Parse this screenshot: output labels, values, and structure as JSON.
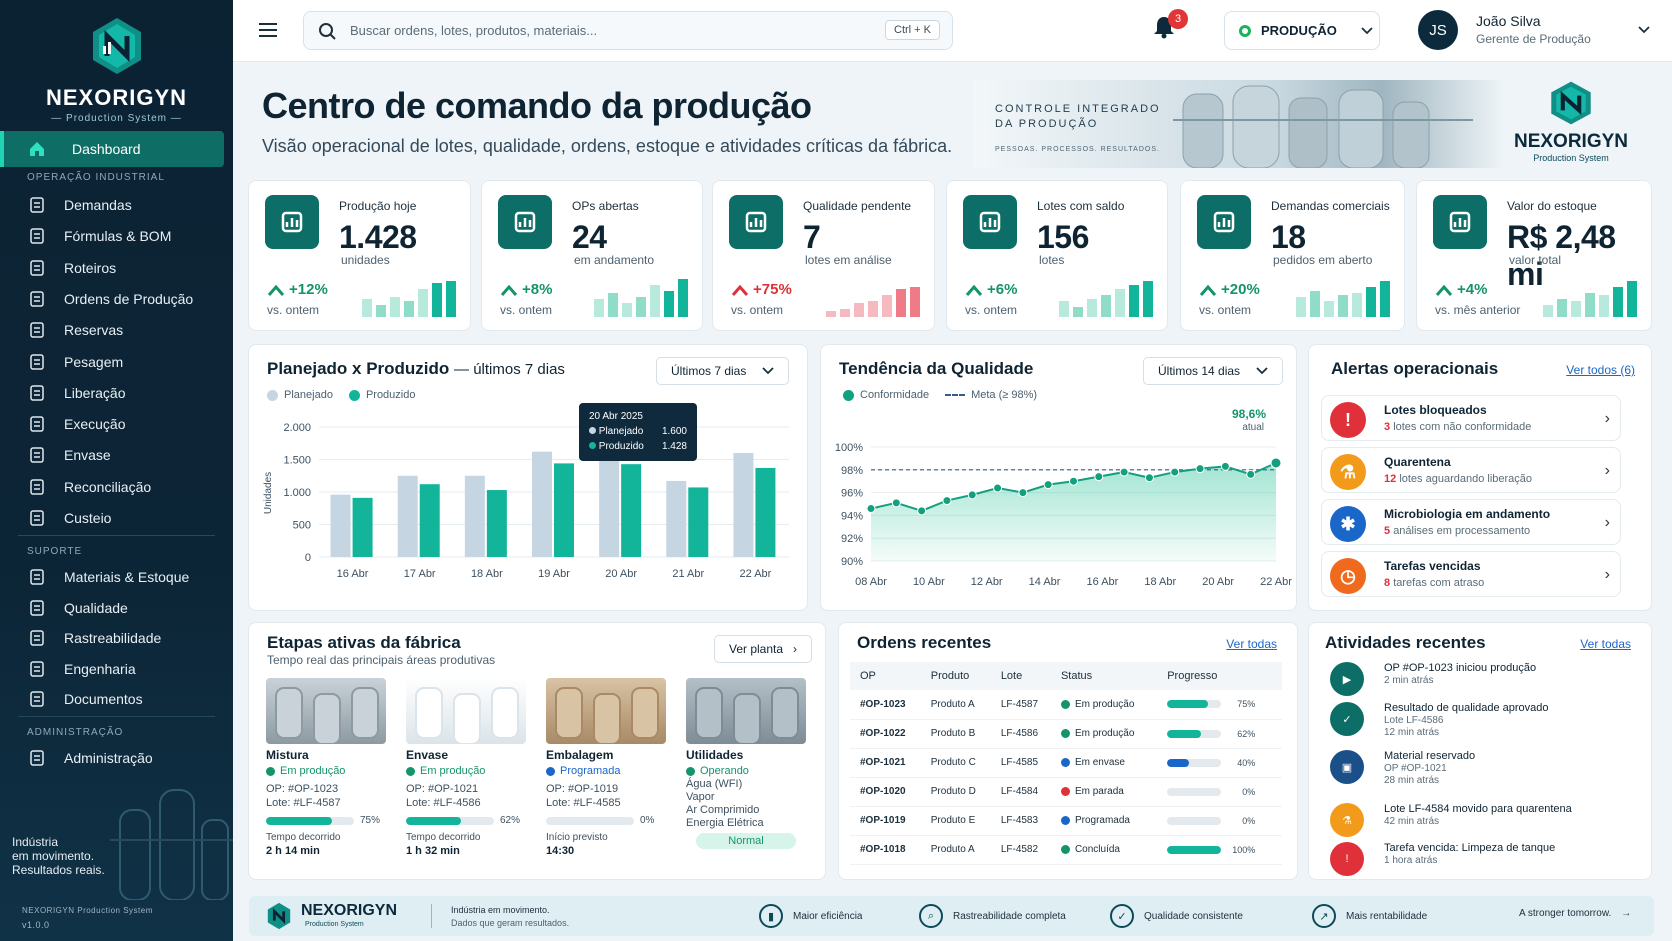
{
  "brand": {
    "name": "NEXORIGYN",
    "subtitle": "Production System"
  },
  "sidebar": {
    "active": "Dashboard",
    "section1": "OPERAÇÃO INDUSTRIAL",
    "items1": [
      "Demandas",
      "Fórmulas & BOM",
      "Roteiros",
      "Ordens de Produção",
      "Reservas",
      "Pesagem",
      "Liberação",
      "Execução",
      "Envase",
      "Reconciliação",
      "Custeio"
    ],
    "section2": "SUPORTE",
    "items2": [
      "Materiais & Estoque",
      "Qualidade",
      "Rastreabilidade",
      "Engenharia",
      "Documentos"
    ],
    "section3": "ADMINISTRAÇÃO",
    "items3": [
      "Administração"
    ],
    "tagline": [
      "Indústria",
      "em movimento.",
      "Resultados reais."
    ],
    "footer": "NEXORIGYN Production System",
    "version": "v1.0.0"
  },
  "topbar": {
    "search_placeholder": "Buscar ordens, lotes, produtos, materiais...",
    "shortcut": "Ctrl + K",
    "notifications": "3",
    "environment": "PRODUÇÃO",
    "user_initials": "JS",
    "user_name": "João Silva",
    "user_role": "Gerente de Produção"
  },
  "header": {
    "title": "Centro de comando da produção",
    "subtitle": "Visão operacional de lotes, qualidade, ordens, estoque e atividades críticas da fábrica.",
    "banner_line1": "CONTROLE INTEGRADO",
    "banner_line2": "DA PRODUÇÃO",
    "banner_small": "PESSOAS. PROCESSOS. RESULTADOS."
  },
  "kpis": [
    {
      "label": "Produção hoje",
      "value": "1.428",
      "unit": "unidades",
      "delta": "+12%",
      "compare": "vs. ontem",
      "trend": "up",
      "spark": [
        0.45,
        0.3,
        0.5,
        0.4,
        0.7,
        0.85,
        0.9
      ]
    },
    {
      "label": "OPs abertas",
      "value": "24",
      "unit": "em andamento",
      "delta": "+8%",
      "compare": "vs. ontem",
      "trend": "up",
      "spark": [
        0.45,
        0.6,
        0.35,
        0.5,
        0.8,
        0.65,
        0.95
      ]
    },
    {
      "label": "Qualidade pendente",
      "value": "7",
      "unit": "lotes em análise",
      "delta": "+75%",
      "compare": "vs. ontem",
      "trend": "down",
      "spark": [
        0.15,
        0.2,
        0.35,
        0.4,
        0.55,
        0.7,
        0.75
      ]
    },
    {
      "label": "Lotes com saldo",
      "value": "156",
      "unit": "lotes",
      "delta": "+6%",
      "compare": "vs. ontem",
      "trend": "up",
      "spark": [
        0.4,
        0.25,
        0.45,
        0.55,
        0.7,
        0.8,
        0.9
      ]
    },
    {
      "label": "Demandas comerciais",
      "value": "18",
      "unit": "pedidos em aberto",
      "delta": "+20%",
      "compare": "vs. ontem",
      "trend": "up",
      "spark": [
        0.5,
        0.65,
        0.4,
        0.55,
        0.6,
        0.75,
        0.9
      ]
    },
    {
      "label": "Valor do estoque",
      "value": "R$ 2,48 mi",
      "unit": "valor total",
      "delta": "+4%",
      "compare": "vs. mês anterior",
      "trend": "up",
      "spark": [
        0.3,
        0.45,
        0.4,
        0.6,
        0.55,
        0.75,
        0.9
      ]
    }
  ],
  "chart_data": [
    {
      "type": "bar",
      "title": "Planejado x Produzido",
      "subtitle": "— últimos 7 dias",
      "filter": "Últimos 7 dias",
      "ylabel": "Unidades",
      "ylim": [
        0,
        2000
      ],
      "yticks": [
        "2.000",
        "1.500",
        "1.000",
        "500",
        "0"
      ],
      "categories": [
        "16 Abr",
        "17 Abr",
        "18 Abr",
        "19 Abr",
        "20 Abr",
        "21 Abr",
        "22 Abr"
      ],
      "series": [
        {
          "name": "Planejado",
          "color": "#c5d6e2",
          "values": [
            960,
            1250,
            1250,
            1620,
            1600,
            1170,
            1600
          ]
        },
        {
          "name": "Produzido",
          "color": "#12b59a",
          "values": [
            910,
            1120,
            1030,
            1440,
            1428,
            1070,
            1370
          ]
        }
      ],
      "tooltip": {
        "date": "20 Abr 2025",
        "planned_label": "Planejado",
        "planned": "1.600",
        "produced_label": "Produzido",
        "produced": "1.428"
      }
    },
    {
      "type": "area",
      "title": "Tendência da Qualidade",
      "filter": "Últimos 14 dias",
      "ylim": [
        90,
        100
      ],
      "yticks": [
        "100%",
        "98%",
        "96%",
        "94%",
        "92%",
        "90%"
      ],
      "xticks": [
        "08 Abr",
        "10 Abr",
        "12 Abr",
        "14 Abr",
        "16 Abr",
        "18 Abr",
        "20 Abr",
        "22 Abr"
      ],
      "series": [
        {
          "name": "Conformidade",
          "color": "#12a07f",
          "values": [
            94.6,
            95.1,
            94.4,
            95.3,
            95.8,
            96.4,
            96.0,
            96.7,
            97.0,
            97.4,
            97.8,
            97.3,
            97.8,
            98.1,
            98.3,
            97.6,
            98.6
          ]
        },
        {
          "name": "Meta (≥ 98%)",
          "values": [
            98
          ]
        }
      ],
      "last_label": "98,6%",
      "last_sub": "atual"
    }
  ],
  "alerts": {
    "title": "Alertas operacionais",
    "link": "Ver todos (6)",
    "items": [
      {
        "title": "Lotes bloqueados",
        "count": "3",
        "text": "lotes com não conformidade",
        "color": "#e0303a",
        "icon": "warning-icon"
      },
      {
        "title": "Quarentena",
        "count": "12",
        "text": "lotes aguardando liberação",
        "color": "#f29a1a",
        "icon": "flask-icon"
      },
      {
        "title": "Microbiologia em andamento",
        "count": "5",
        "text": "análises em processamento",
        "color": "#1b66c9",
        "icon": "microbe-icon"
      },
      {
        "title": "Tarefas vencidas",
        "count": "8",
        "text": "tarefas com atraso",
        "color": "#f06a1e",
        "icon": "clock-icon"
      }
    ]
  },
  "stages": {
    "title": "Etapas ativas da fábrica",
    "subtitle": "Tempo real das principais áreas produtivas",
    "button": "Ver planta",
    "items": [
      {
        "name": "Mistura",
        "status": "Em produção",
        "op": "OP:  #OP-1023",
        "lote": "Lote: #LF-4587",
        "progress": 75,
        "progress_label": "75%",
        "time_label": "Tempo decorrido",
        "time": "2 h 14 min",
        "statusColor": "#14946d"
      },
      {
        "name": "Envase",
        "status": "Em produção",
        "op": "OP:  #OP-1021",
        "lote": "Lote: #LF-4586",
        "progress": 62,
        "progress_label": "62%",
        "time_label": "Tempo decorrido",
        "time": "1 h 32 min",
        "statusColor": "#14946d"
      },
      {
        "name": "Embalagem",
        "status": "Programada",
        "op": "OP:  #OP-1019",
        "lote": "Lote: #LF-4585",
        "progress": 0,
        "progress_label": "0%",
        "time_label": "Início previsto",
        "time": "14:30",
        "statusColor": "#1b66c9"
      },
      {
        "name": "Utilidades",
        "status": "Operando",
        "lines": [
          "Água (WFI)",
          "Vapor",
          "Ar Comprimido",
          "Energia Elétrica"
        ],
        "badge": "Normal",
        "statusColor": "#14946d"
      }
    ]
  },
  "orders": {
    "title": "Ordens recentes",
    "link": "Ver todas",
    "columns": [
      "OP",
      "Produto",
      "Lote",
      "Status",
      "Progresso"
    ],
    "rows": [
      {
        "op": "#OP-1023",
        "produto": "Produto A",
        "lote": "LF-4587",
        "status": "Em produção",
        "color": "#14946d",
        "progress": 75,
        "label": "75%"
      },
      {
        "op": "#OP-1022",
        "produto": "Produto B",
        "lote": "LF-4586",
        "status": "Em produção",
        "color": "#14946d",
        "progress": 62,
        "label": "62%"
      },
      {
        "op": "#OP-1021",
        "produto": "Produto C",
        "lote": "LF-4585",
        "status": "Em envase",
        "color": "#1b66c9",
        "progress": 40,
        "label": "40%"
      },
      {
        "op": "#OP-1020",
        "produto": "Produto D",
        "lote": "LF-4584",
        "status": "Em parada",
        "color": "#e0303a",
        "progress": 0,
        "label": "0%"
      },
      {
        "op": "#OP-1019",
        "produto": "Produto E",
        "lote": "LF-4583",
        "status": "Programada",
        "color": "#1b66c9",
        "progress": 0,
        "label": "0%"
      },
      {
        "op": "#OP-1018",
        "produto": "Produto A",
        "lote": "LF-4582",
        "status": "Concluída",
        "color": "#14946d",
        "progress": 100,
        "label": "100%"
      }
    ]
  },
  "activities": {
    "title": "Atividades recentes",
    "link": "Ver todas",
    "items": [
      {
        "t": "OP #OP-1023 iniciou produção",
        "s": [
          "2 min atrás"
        ],
        "color": "#0c6e66",
        "icon": "play-icon"
      },
      {
        "t": "Resultado de qualidade aprovado",
        "s": [
          "Lote LF-4586",
          "12 min atrás"
        ],
        "color": "#0c6e66",
        "icon": "check-icon"
      },
      {
        "t": "Material reservado",
        "s": [
          "OP #OP-1021",
          "28 min atrás"
        ],
        "color": "#1b4f8a",
        "icon": "box-icon"
      },
      {
        "t": "Lote LF-4584 movido para quarentena",
        "s": [
          "42 min atrás"
        ],
        "color": "#f29a1a",
        "icon": "flask-icon"
      },
      {
        "t": "Tarefa vencida: Limpeza de tanque",
        "s": [
          "1 hora atrás"
        ],
        "color": "#e0303a",
        "icon": "alert-icon"
      }
    ]
  },
  "footer": {
    "tagline1": "Indústria em movimento.",
    "tagline2": "Dados que geram resultados.",
    "items": [
      "Maior eficiência",
      "Rastreabilidade completa",
      "Qualidade consistente",
      "Mais rentabilidade"
    ],
    "cta": "A stronger tomorrow."
  }
}
